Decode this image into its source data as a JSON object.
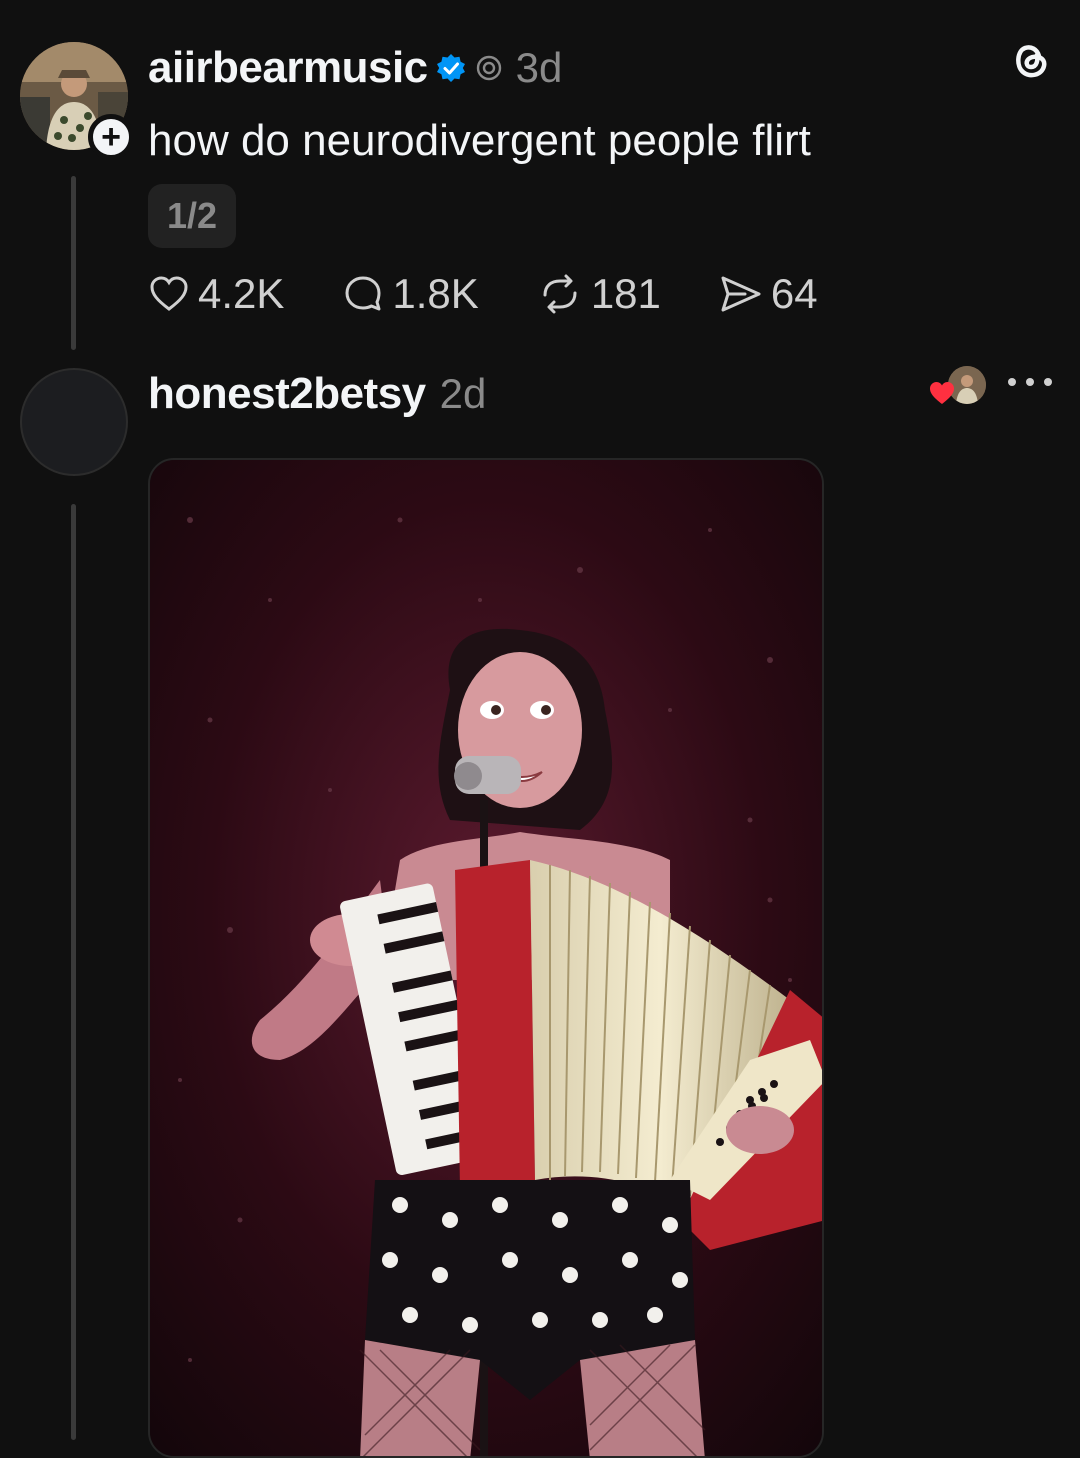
{
  "post": {
    "username": "aiirbearmusic",
    "time": "3d",
    "text": "how do neurodivergent people flirt",
    "page_indicator": "1/2",
    "follow_symbol": "+",
    "stats": {
      "likes": "4.2K",
      "replies": "1.8K",
      "reposts": "181",
      "shares": "64"
    }
  },
  "reply": {
    "username": "honest2betsy",
    "time": "2d"
  },
  "icons": {
    "verified": "verified-badge-icon",
    "threads_logo": "threads-logo-icon",
    "like": "heart-icon",
    "reply": "comment-icon",
    "repost": "repost-icon",
    "share": "send-icon",
    "more": "more-icon"
  },
  "colors": {
    "background": "#101010",
    "verified": "#0095f6",
    "liked_heart": "#ff3040"
  }
}
